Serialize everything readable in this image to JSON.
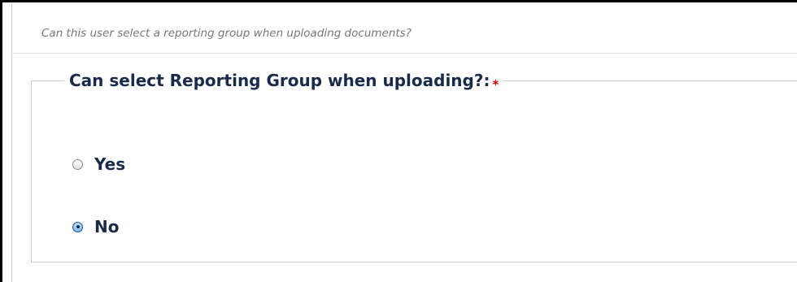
{
  "help_text": "Can this user select a reporting group when uploading documents?",
  "field": {
    "label": "Can select Reporting Group when uploading?:",
    "required_marker": "*"
  },
  "options": [
    {
      "label": "Yes",
      "selected": false
    },
    {
      "label": "No",
      "selected": true
    }
  ],
  "colors": {
    "label_text": "#1a2b4a",
    "help_text": "#777777",
    "required": "#d40000",
    "border": "#cccccc"
  },
  "icons": {
    "radio_unselected": "radio-unselected-icon",
    "radio_selected": "radio-selected-icon"
  }
}
